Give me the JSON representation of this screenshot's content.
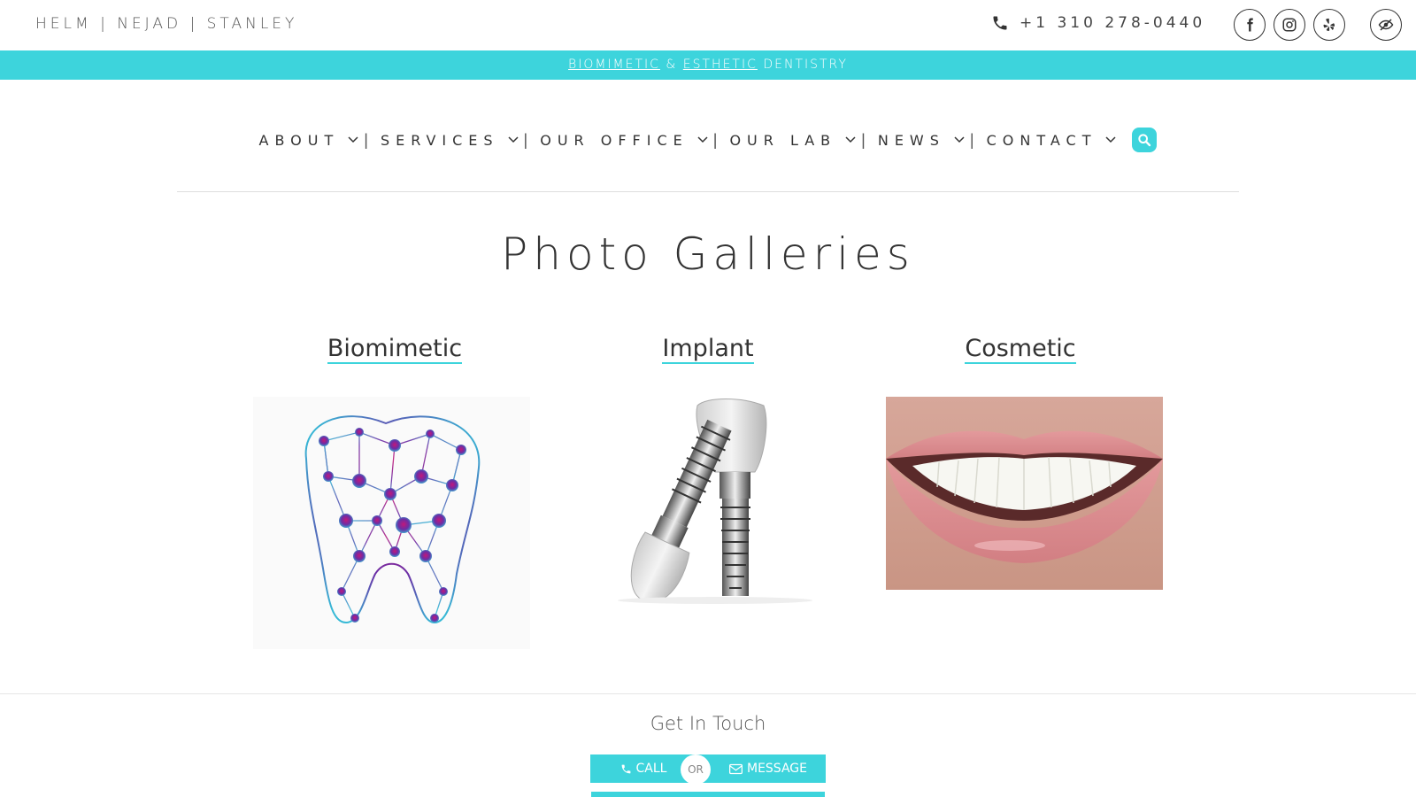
{
  "header": {
    "brand": "HELM | NEJAD | STANLEY",
    "phone": "+1 310 278-0440",
    "social": [
      "facebook-icon",
      "instagram-icon",
      "yelp-icon"
    ],
    "accessibility_icon": "eye-slash-icon"
  },
  "tagline": {
    "biomimetic": "BIOMIMETIC",
    "amp": " & ",
    "esthetic": "ESTHETIC",
    "dentistry": " DENTISTRY"
  },
  "nav": {
    "items": [
      {
        "label": "ABOUT"
      },
      {
        "label": "SERVICES"
      },
      {
        "label": "OUR OFFICE"
      },
      {
        "label": "OUR LAB"
      },
      {
        "label": "NEWS"
      },
      {
        "label": "CONTACT"
      }
    ],
    "separator": "|"
  },
  "page": {
    "title": "Photo Galleries"
  },
  "galleries": [
    {
      "label": "Biomimetic"
    },
    {
      "label": "Implant"
    },
    {
      "label": "Cosmetic"
    }
  ],
  "touch": {
    "title": "Get In Touch",
    "call": "CALL",
    "or": "OR",
    "message": "MESSAGE"
  },
  "colors": {
    "accent": "#3dd4dc",
    "text": "#333333"
  }
}
